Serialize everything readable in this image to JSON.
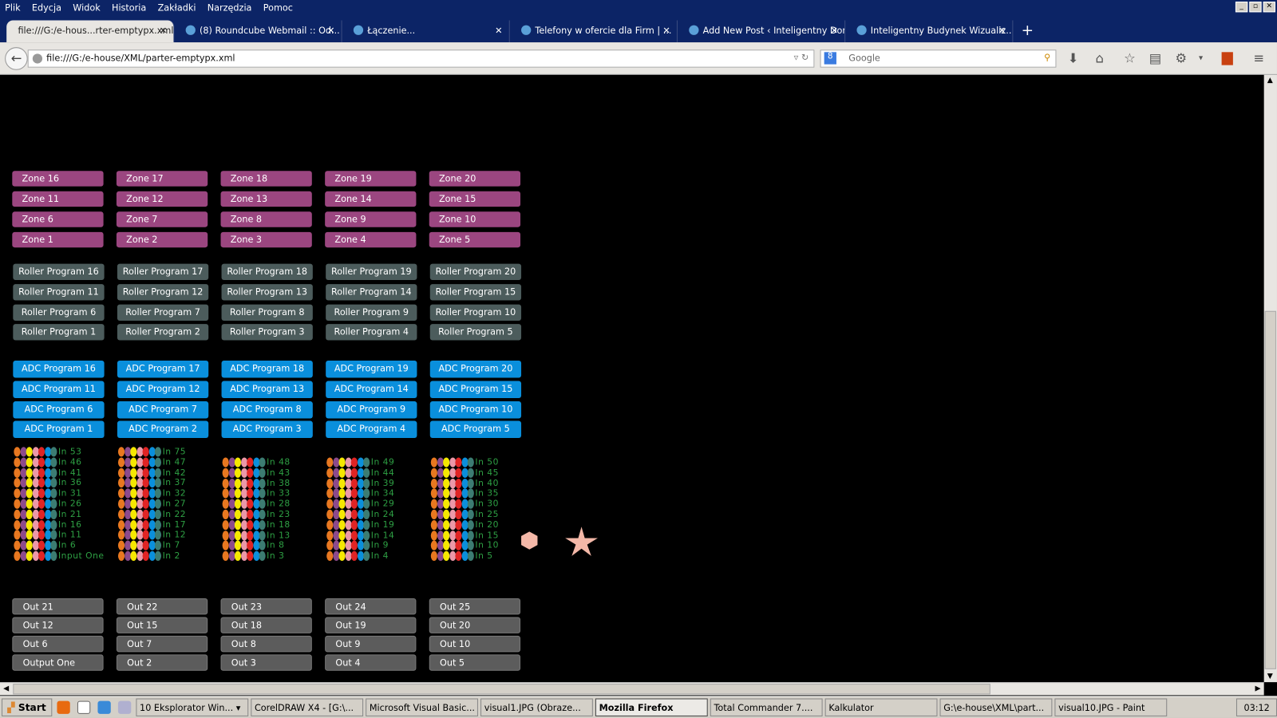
{
  "browser": {
    "menu": [
      "Plik",
      "Edycja",
      "Widok",
      "Historia",
      "Zakładki",
      "Narzędzia",
      "Pomoc"
    ],
    "tabs": [
      {
        "label": "file:///G:/e-hous...rter-emptypx.xml",
        "active": true
      },
      {
        "label": "(8) Roundcube Webmail :: Od..."
      },
      {
        "label": "Łączenie..."
      },
      {
        "label": "Telefony w ofercie dla Firm | ..."
      },
      {
        "label": "Add New Post ‹ Inteligentny Dom,..."
      },
      {
        "label": "Inteligentny Budynek Wizualiz..."
      }
    ],
    "url": "file:///G:/e-house/XML/parter-emptypx.xml",
    "search_placeholder": "Google"
  },
  "colors": {
    "zone": "#9b4680",
    "roller": "#4c5c5c",
    "adc": "#0a8fdc",
    "out": "#5c5c5c",
    "input_label": "#2ea044",
    "dots": [
      "#e87820",
      "#8c4a8c",
      "#f5e800",
      "#ec98a8",
      "#e02424",
      "#0a8fdc",
      "#3c7c72"
    ],
    "shapes": "#f4b8a8"
  },
  "zones": [
    [
      "Zone 16",
      "Zone 17",
      "Zone 18",
      "Zone 19",
      "Zone 20"
    ],
    [
      "Zone 11",
      "Zone 12",
      "Zone 13",
      "Zone 14",
      "Zone 15"
    ],
    [
      "Zone 6",
      "Zone 7",
      "Zone 8",
      "Zone 9",
      "Zone 10"
    ],
    [
      "Zone 1",
      "Zone 2",
      "Zone 3",
      "Zone 4",
      "Zone 5"
    ]
  ],
  "rollers": [
    [
      "Roller Program 16",
      "Roller Program 17",
      "Roller Program 18",
      "Roller Program 19",
      "Roller Program 20"
    ],
    [
      "Roller Program 11",
      "Roller Program 12",
      "Roller Program 13",
      "Roller Program 14",
      "Roller Program 15"
    ],
    [
      "Roller Program 6",
      "Roller Program 7",
      "Roller Program 8",
      "Roller Program 9",
      "Roller Program 10"
    ],
    [
      "Roller Program 1",
      "Roller Program 2",
      "Roller Program 3",
      "Roller Program 4",
      "Roller Program 5"
    ]
  ],
  "adc": [
    [
      "ADC Program 16",
      "ADC Program 17",
      "ADC Program 18",
      "ADC Program 19",
      "ADC Program 20"
    ],
    [
      "ADC Program 11",
      "ADC Program 12",
      "ADC Program 13",
      "ADC Program 14",
      "ADC Program 15"
    ],
    [
      "ADC Program 6",
      "ADC Program 7",
      "ADC Program 8",
      "ADC Program 9",
      "ADC Program 10"
    ],
    [
      "ADC Program 1",
      "ADC Program 2",
      "ADC Program 3",
      "ADC Program 4",
      "ADC Program 5"
    ]
  ],
  "inputs": [
    [
      "In 53",
      "In 46",
      "In 41",
      "In 36",
      "In 31",
      "In 26",
      "In 21",
      "In 16",
      "In 11",
      "In 6",
      "Input One"
    ],
    [
      "In 75",
      "In 47",
      "In 42",
      "In 37",
      "In 32",
      "In 27",
      "In 22",
      "In 17",
      "In 12",
      "In 7",
      "In 2"
    ],
    [
      "In 48",
      "In 43",
      "In 38",
      "In 33",
      "In 28",
      "In 23",
      "In 18",
      "In 13",
      "In 8",
      "In 3"
    ],
    [
      "In 49",
      "In 44",
      "In 39",
      "In 34",
      "In 29",
      "In 24",
      "In 19",
      "In 14",
      "In 9",
      "In 4"
    ],
    [
      "In 50",
      "In 45",
      "In 40",
      "In 35",
      "In 30",
      "In 25",
      "In 20",
      "In 15",
      "In 10",
      "In 5"
    ]
  ],
  "outputs": [
    [
      "Out 21",
      "Out 22",
      "Out 23",
      "Out 24",
      "Out 25"
    ],
    [
      "Out 12",
      "Out 15",
      "Out 18",
      "Out 19",
      "Out 20"
    ],
    [
      "Out 6",
      "Out 7",
      "Out 8",
      "Out 9",
      "Out 10"
    ],
    [
      "Output One",
      "Out 2",
      "Out 3",
      "Out 4",
      "Out 5"
    ]
  ],
  "taskbar": {
    "start": "Start",
    "items": [
      {
        "label": "10 Eksplorator Win... ▾"
      },
      {
        "label": "CorelDRAW X4 - [G:\\..."
      },
      {
        "label": "Microsoft Visual Basic..."
      },
      {
        "label": "visual1.JPG (Obraze..."
      },
      {
        "label": "Mozilla Firefox",
        "active": true
      },
      {
        "label": "Total Commander 7...."
      },
      {
        "label": "Kalkulator"
      },
      {
        "label": "G:\\e-house\\XML\\part..."
      },
      {
        "label": "visual10.JPG - Paint"
      }
    ],
    "clock": "03:12"
  }
}
